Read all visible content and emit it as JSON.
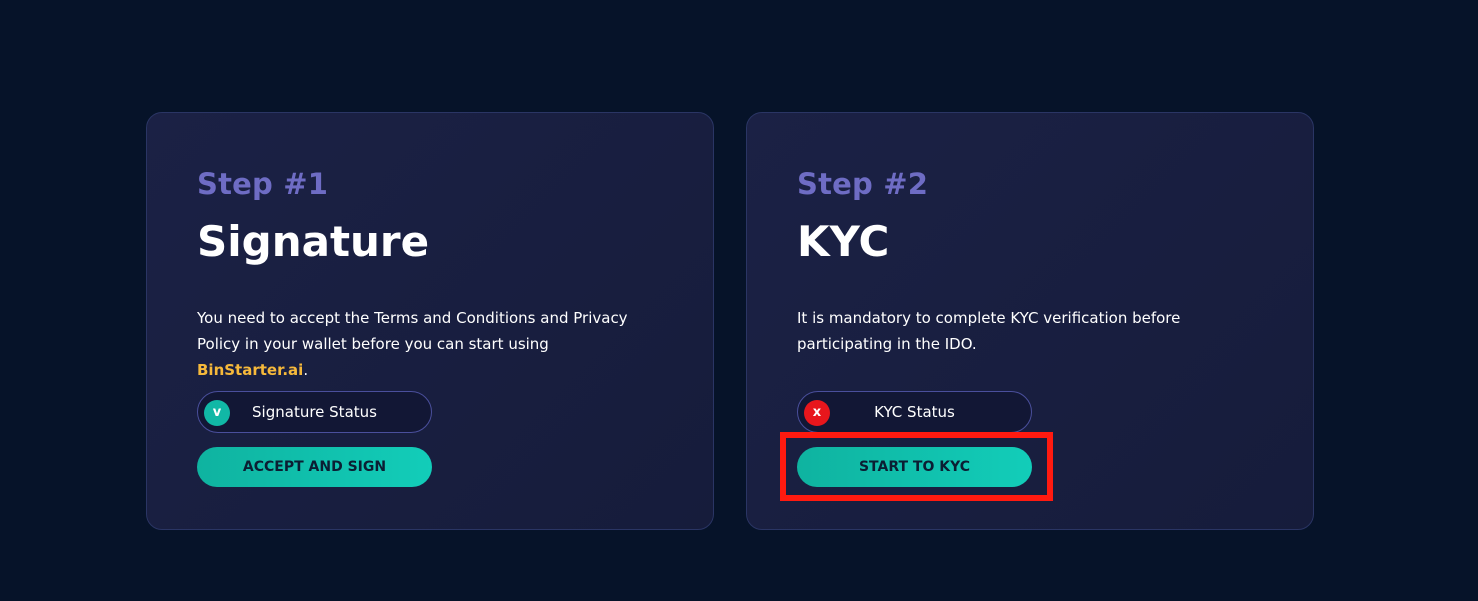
{
  "steps": [
    {
      "label": "Step #1",
      "title": "Signature",
      "description": "You need to accept the Terms and Conditions and Privacy Policy in your wallet before you can start using ",
      "brand": "BinStarter.ai",
      "description_end": ".",
      "status_label": "Signature Status",
      "status_icon": "v",
      "status_color": "#11b8a6",
      "button_label": "ACCEPT AND SIGN"
    },
    {
      "label": "Step #2",
      "title": "KYC",
      "description": "It is mandatory to complete KYC verification before participating in the IDO.",
      "status_label": "KYC Status",
      "status_icon": "x",
      "status_color": "#e8161c",
      "button_label": "START TO KYC"
    }
  ],
  "colors": {
    "background": "#061329",
    "step_label": "#6e6cc4",
    "brand": "#f6b93b",
    "button": "#12cdb9",
    "highlight": "#ff1a10"
  }
}
